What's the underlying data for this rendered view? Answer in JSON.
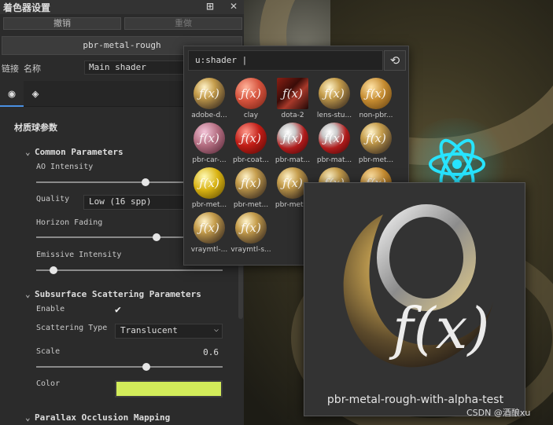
{
  "panel": {
    "title": "着色器设置",
    "undo_label": "撤销",
    "redo_label": "重做",
    "shader_name": "pbr-metal-rough",
    "link_label": "链接",
    "name_label": "名称",
    "name_value": "Main shader",
    "section_title": "材质球参数"
  },
  "groups": {
    "common": "Common Parameters",
    "subsurface": "Subsurface Scattering Parameters",
    "parallax": "Parallax Occlusion Mapping"
  },
  "params": {
    "ao_intensity": {
      "label": "AO Intensity",
      "value": 0.6
    },
    "quality": {
      "label": "Quality",
      "value": "Low (16 spp)"
    },
    "horizon_fading": {
      "label": "Horizon Fading",
      "value": 0.65
    },
    "emissive_intensity": {
      "label": "Emissive Intensity",
      "value": 0.09
    },
    "enable": {
      "label": "Enable",
      "checked": true
    },
    "scattering_type": {
      "label": "Scattering Type",
      "value": "Translucent"
    },
    "scale": {
      "label": "Scale",
      "value": "0.6",
      "slider": 0.6
    },
    "color": {
      "label": "Color",
      "value": "#d2ec5a"
    }
  },
  "popup": {
    "search_value": "u:shader |",
    "items": [
      {
        "label": "adobe-d...",
        "style": "gold"
      },
      {
        "label": "clay",
        "style": "clay"
      },
      {
        "label": "dota-2",
        "style": "dota"
      },
      {
        "label": "lens-stu...",
        "style": "gold"
      },
      {
        "label": "non-pbr...",
        "style": "amber"
      },
      {
        "label": "pbr-car-...",
        "style": "pink"
      },
      {
        "label": "pbr-coat...",
        "style": "red"
      },
      {
        "label": "pbr-mat...",
        "style": "redsilver"
      },
      {
        "label": "pbr-mat...",
        "style": "redsilver"
      },
      {
        "label": "pbr-met...",
        "style": "gold"
      },
      {
        "label": "pbr-met...",
        "style": "yellow"
      },
      {
        "label": "pbr-met...",
        "style": "gold"
      },
      {
        "label": "pbr-met...",
        "style": "gold"
      },
      {
        "label": "",
        "style": "gold"
      },
      {
        "label": "",
        "style": "amber"
      },
      {
        "label": "vraymtl-...",
        "style": "gold"
      },
      {
        "label": "vraymtl-s...",
        "style": "gold"
      }
    ]
  },
  "preview": {
    "label": "pbr-metal-rough-with-alpha-test"
  },
  "watermark": "CSDN @酒酿xu"
}
